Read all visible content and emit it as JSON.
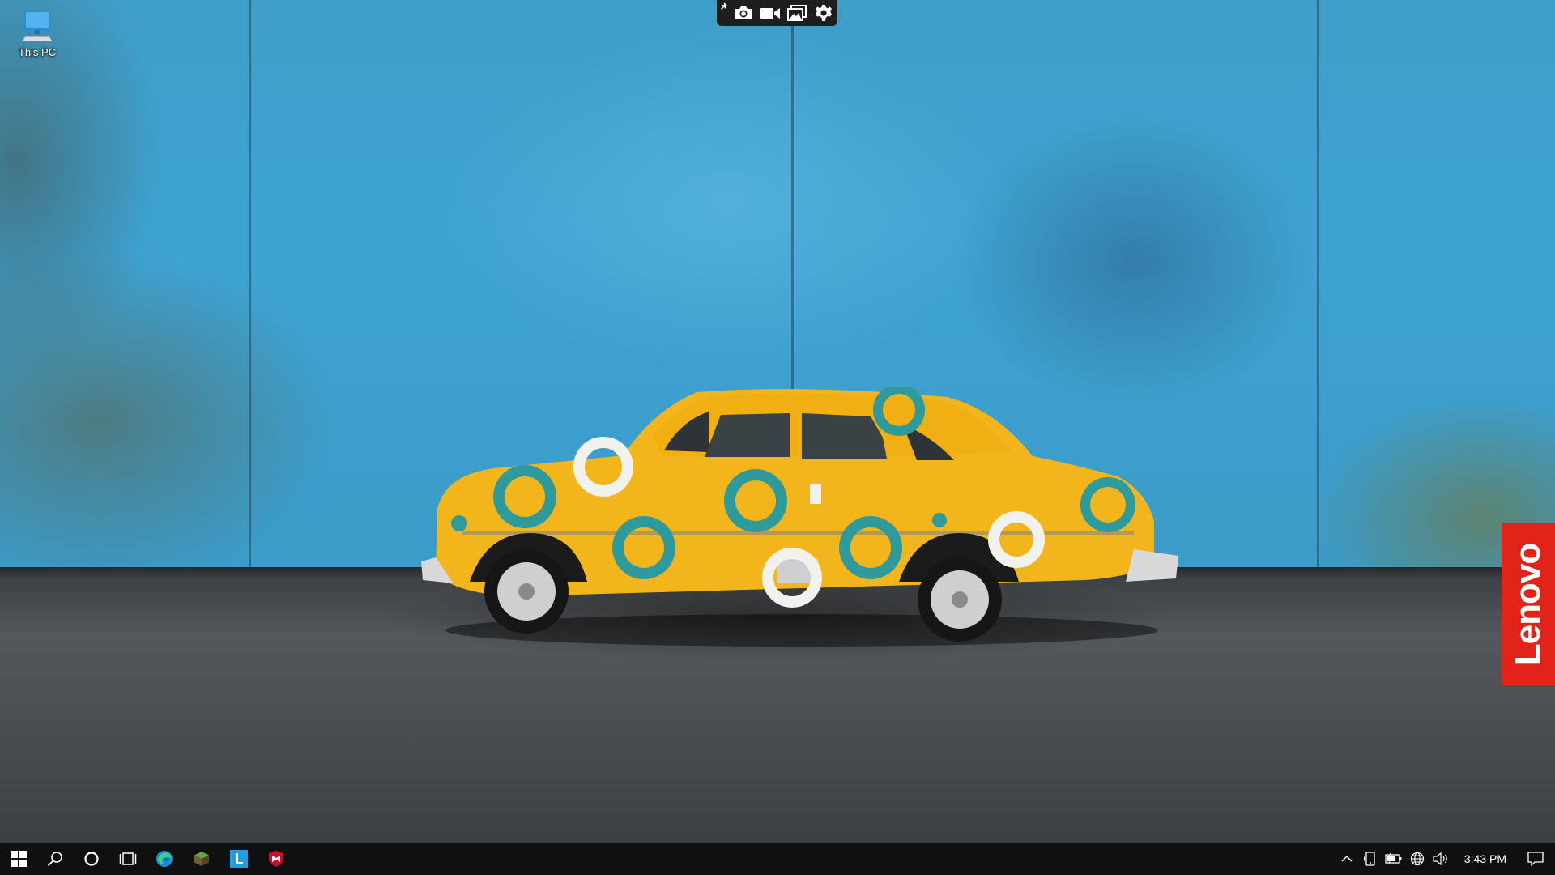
{
  "desktop": {
    "icons": [
      {
        "label": "This PC",
        "icon": "computer-icon"
      }
    ]
  },
  "capture_toolbar": {
    "buttons": [
      "pin-icon",
      "camera-icon",
      "video-camera-icon",
      "gallery-icon",
      "gear-icon"
    ]
  },
  "wallpaper": {
    "brand_text": "Lenovo",
    "brand_color": "#e2231a",
    "wall_color": "#3ea3d3",
    "car_color": "#f2b51b"
  },
  "taskbar": {
    "pinned": [
      "windows-start-icon",
      "search-icon",
      "cortana-icon",
      "task-view-icon",
      "edge-icon",
      "minecraft-icon",
      "lenovo-vantage-icon",
      "mcafee-icon"
    ],
    "tray": [
      "chevron-up-icon",
      "tablet-icon",
      "battery-icon",
      "globe-network-icon",
      "volume-icon",
      "notification-icon"
    ],
    "clock": "3:43 PM"
  }
}
